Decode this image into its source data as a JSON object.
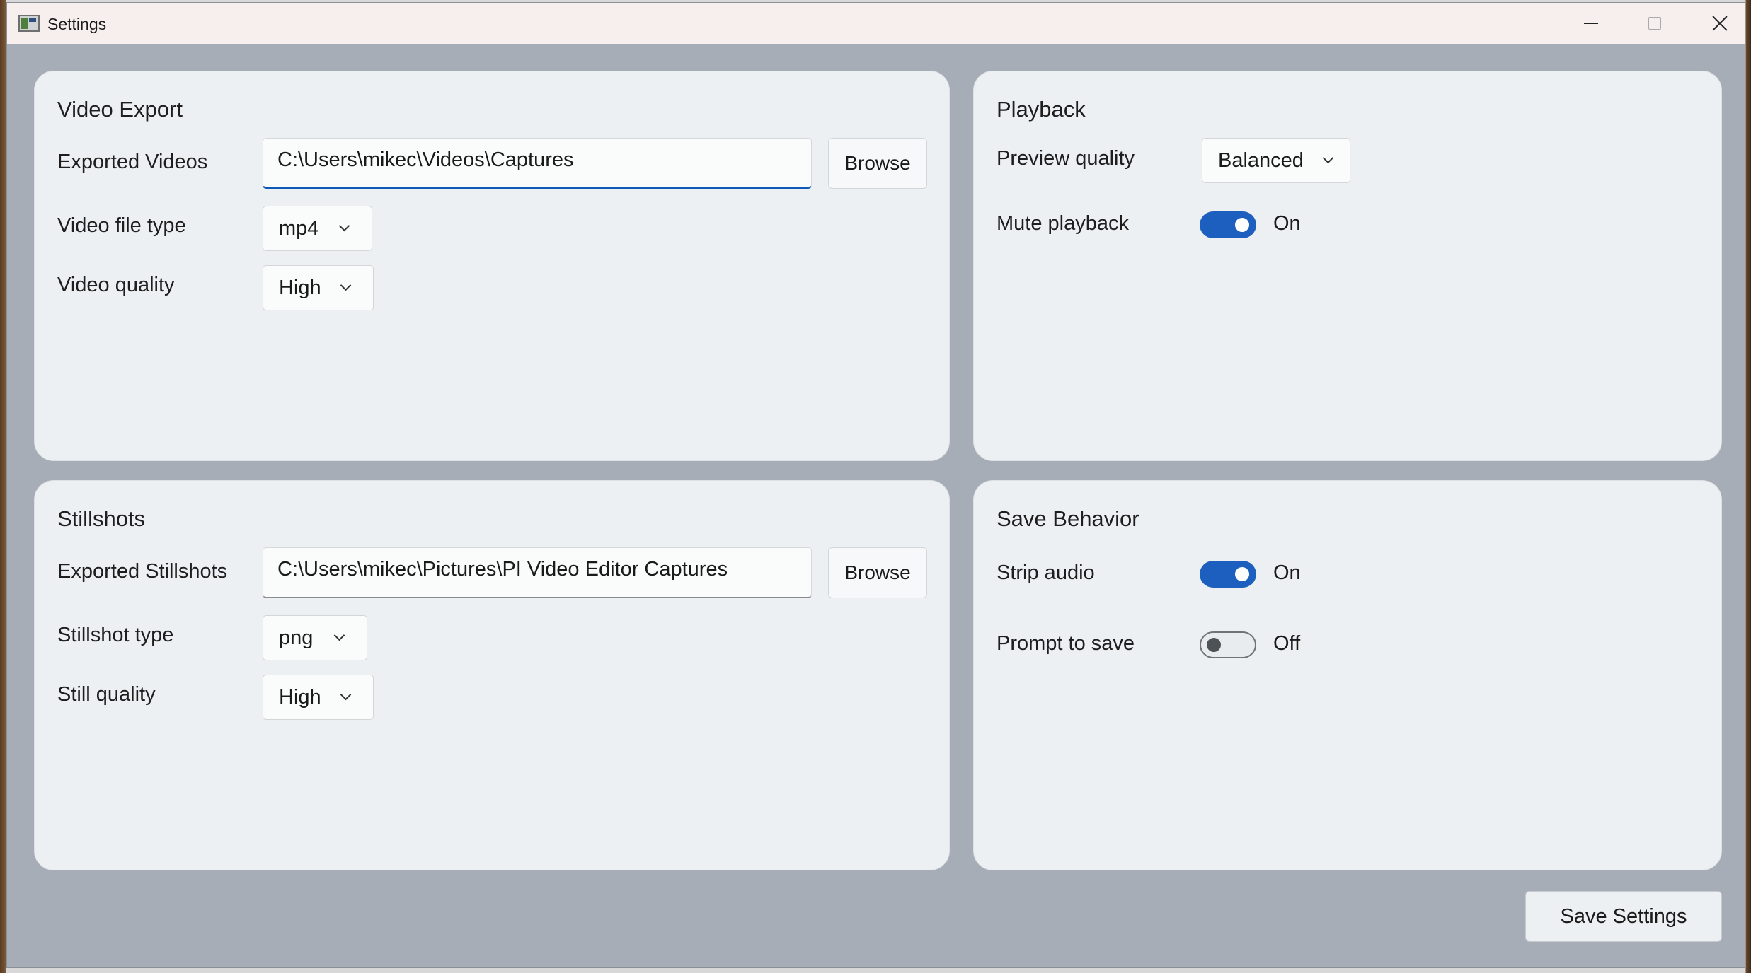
{
  "window": {
    "title": "Settings"
  },
  "video_export": {
    "title": "Video Export",
    "exported_videos_label": "Exported Videos",
    "exported_videos_value": "C:\\Users\\mikec\\Videos\\Captures",
    "browse_label": "Browse",
    "file_type_label": "Video file type",
    "file_type_value": "mp4",
    "quality_label": "Video quality",
    "quality_value": "High"
  },
  "playback": {
    "title": "Playback",
    "preview_quality_label": "Preview quality",
    "preview_quality_value": "Balanced",
    "mute_label": "Mute playback",
    "mute_state": "On"
  },
  "stillshots": {
    "title": "Stillshots",
    "exported_label": "Exported Stillshots",
    "exported_value": "C:\\Users\\mikec\\Pictures\\PI Video Editor Captures",
    "browse_label": "Browse",
    "type_label": "Stillshot type",
    "type_value": "png",
    "quality_label": "Still quality",
    "quality_value": "High"
  },
  "save_behavior": {
    "title": "Save Behavior",
    "strip_audio_label": "Strip audio",
    "strip_audio_state": "On",
    "prompt_label": "Prompt to save",
    "prompt_state": "Off"
  },
  "footer": {
    "save_label": "Save Settings"
  },
  "colors": {
    "accent": "#1d5fbf",
    "card_bg": "#edf0f2",
    "window_bg": "#a7adb6"
  }
}
